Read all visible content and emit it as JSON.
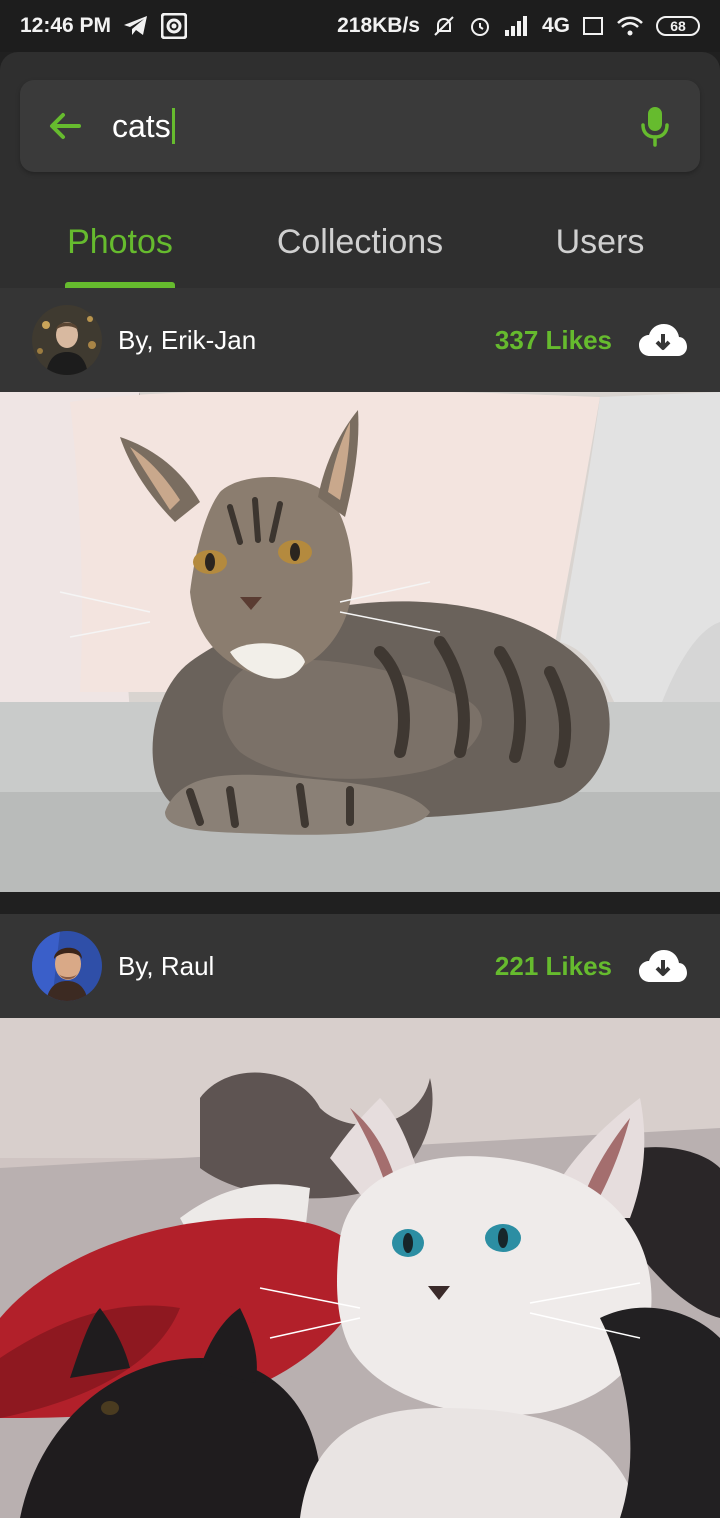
{
  "status_bar": {
    "time": "12:46 PM",
    "network_speed": "218KB/s",
    "network_type": "4G",
    "battery": "68"
  },
  "search": {
    "query": "cats",
    "back_icon": "arrow-back-icon",
    "mic_icon": "mic-icon"
  },
  "tabs": [
    {
      "label": "Photos",
      "active": true
    },
    {
      "label": "Collections",
      "active": false
    },
    {
      "label": "Users",
      "active": false
    }
  ],
  "results": [
    {
      "author": "By, Erik-Jan",
      "likes": "337 Likes",
      "image_subject": "tabby cat lying on sofa"
    },
    {
      "author": "By, Raul",
      "likes": "221 Likes",
      "image_subject": "white and black kittens"
    }
  ],
  "colors": {
    "accent": "#66bb2e",
    "header_bg": "#2f2f2f",
    "card_header_bg": "#353535",
    "background": "#202020"
  }
}
